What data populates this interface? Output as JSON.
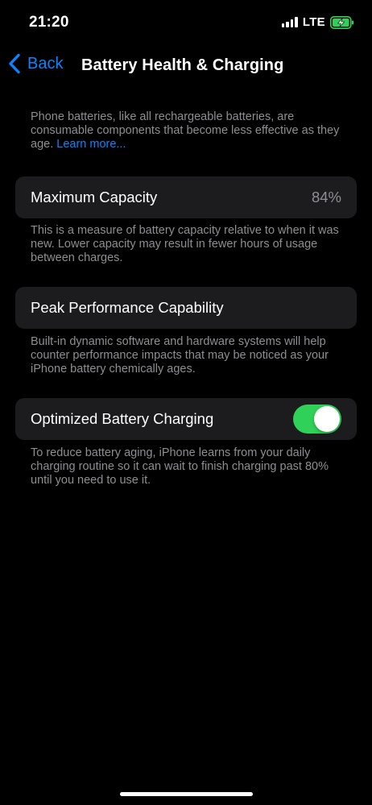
{
  "status_bar": {
    "time": "21:20",
    "network": "LTE",
    "battery_state": "charging",
    "battery_color": "#30d158"
  },
  "nav": {
    "back_label": "Back",
    "title": "Battery Health & Charging"
  },
  "intro": {
    "text": "Phone batteries, like all rechargeable batteries, are consumable components that become less effective as they age. ",
    "link": "Learn more..."
  },
  "maximum_capacity": {
    "label": "Maximum Capacity",
    "value": "84%",
    "footer": "This is a measure of battery capacity relative to when it was new. Lower capacity may result in fewer hours of usage between charges."
  },
  "peak_performance": {
    "label": "Peak Performance Capability",
    "footer": "Built-in dynamic software and hardware systems will help counter performance impacts that may be noticed as your iPhone battery chemically ages."
  },
  "optimized_charging": {
    "label": "Optimized Battery Charging",
    "enabled": true,
    "toggle_color": "#30d158",
    "footer": "To reduce battery aging, iPhone learns from your daily charging routine so it can wait to finish charging past 80% until you need to use it."
  },
  "colors": {
    "accent": "#0a84ff",
    "background": "#000000",
    "cell_background": "#1c1c1e",
    "secondary_text": "#8e8e93"
  }
}
